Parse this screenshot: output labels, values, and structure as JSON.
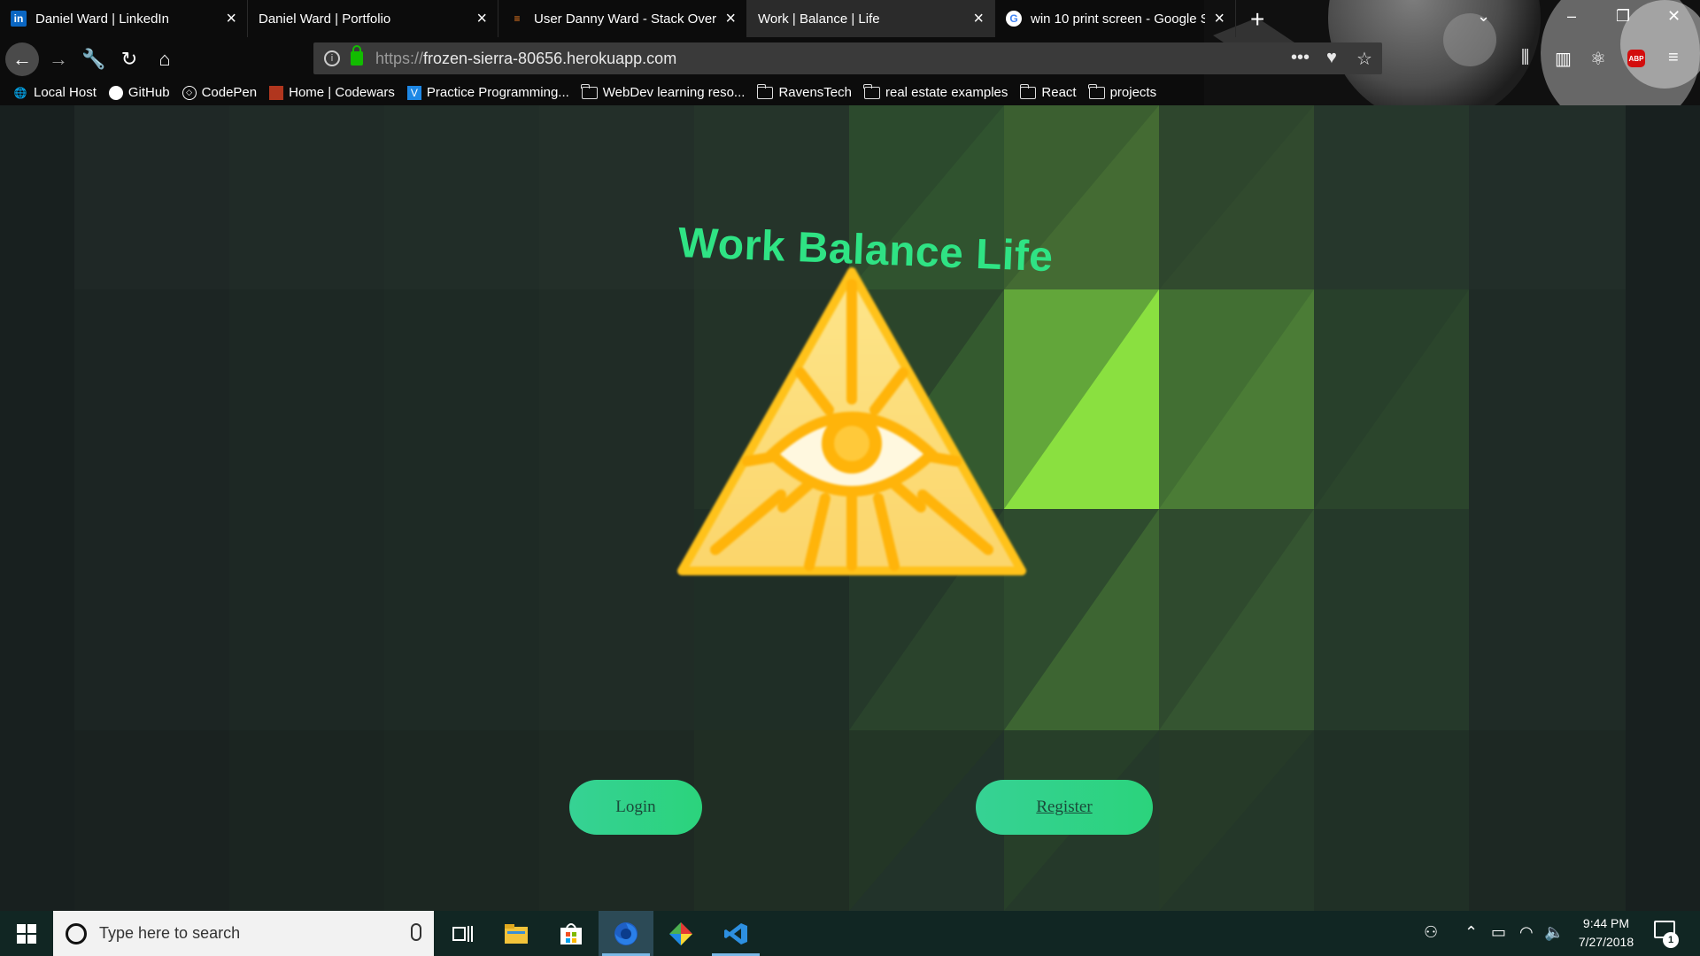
{
  "browser": {
    "tabs": [
      {
        "title": "Daniel Ward | LinkedIn",
        "favicon": "linkedin-icon",
        "active": false
      },
      {
        "title": "Daniel Ward | Portfolio",
        "favicon": "",
        "active": false
      },
      {
        "title": "User Danny Ward - Stack Overf",
        "favicon": "stackoverflow-icon",
        "active": false
      },
      {
        "title": "Work | Balance | Life",
        "favicon": "",
        "active": true
      },
      {
        "title": "win 10 print screen - Google Se",
        "favicon": "google-icon",
        "active": false
      }
    ],
    "url_protocol": "https://",
    "url_host": "frozen-sierra-80656.herokuapp.com",
    "bookmarks": [
      {
        "label": "Local Host",
        "icon": "globe-icon"
      },
      {
        "label": "GitHub",
        "icon": "github-icon"
      },
      {
        "label": "CodePen",
        "icon": "codepen-icon"
      },
      {
        "label": "Home | Codewars",
        "icon": "codewars-icon"
      },
      {
        "label": "Practice Programming...",
        "icon": "practice-icon"
      },
      {
        "label": "WebDev learning reso...",
        "icon": "folder-icon"
      },
      {
        "label": "RavensTech",
        "icon": "folder-icon"
      },
      {
        "label": "real estate examples",
        "icon": "folder-icon"
      },
      {
        "label": "React",
        "icon": "folder-icon"
      },
      {
        "label": "projects",
        "icon": "folder-icon"
      }
    ]
  },
  "page": {
    "title": "Work Balance Life",
    "login_label": "Login",
    "register_label": "Register",
    "accent_color": "#2fe384"
  },
  "taskbar": {
    "search_placeholder": "Type here to search",
    "time": "9:44 PM",
    "date": "7/27/2018",
    "notification_count": "1"
  }
}
